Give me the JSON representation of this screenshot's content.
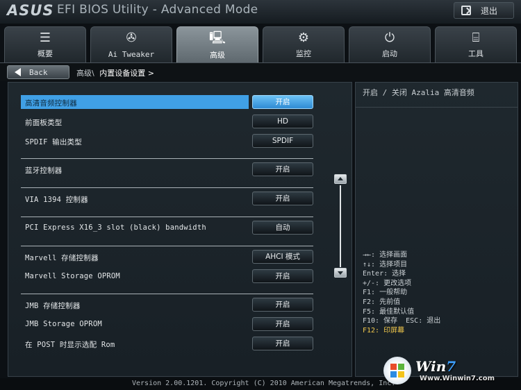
{
  "header": {
    "logo": "ASUS",
    "title": "EFI BIOS Utility - Advanced Mode",
    "exit_label": "退出"
  },
  "tabs": [
    {
      "label": "概要",
      "icon": "list-icon"
    },
    {
      "label": "Ai Tweaker",
      "icon": "fan-icon"
    },
    {
      "label": "高级",
      "icon": "info-monitor-icon",
      "active": true
    },
    {
      "label": "监控",
      "icon": "gauge-icon"
    },
    {
      "label": "启动",
      "icon": "power-icon"
    },
    {
      "label": "工具",
      "icon": "toolbox-icon"
    }
  ],
  "nav": {
    "back_label": "Back",
    "crumb_parent": "高级\\",
    "crumb_current": "内置设备设置 >"
  },
  "settings": [
    {
      "label": "高清音频控制器",
      "value": "开启",
      "selected": true
    },
    {
      "label": "前面板类型",
      "value": "HD"
    },
    {
      "label": "SPDIF 输出类型",
      "value": "SPDIF"
    },
    {
      "label": "蓝牙控制器",
      "value": "开启"
    },
    {
      "label": "VIA 1394 控制器",
      "value": "开启"
    },
    {
      "label": "PCI Express X16_3 slot (black) bandwidth",
      "value": "自动"
    },
    {
      "label": "Marvell 存储控制器",
      "value": "AHCI 模式"
    },
    {
      "label": "Marvell Storage OPROM",
      "value": "开启"
    },
    {
      "label": "JMB 存储控制器",
      "value": "开启"
    },
    {
      "label": "JMB Storage OPROM",
      "value": "开启"
    },
    {
      "label": "在 POST 时显示选配 Rom",
      "value": "开启"
    }
  ],
  "help": {
    "description": "开启 / 关闭 Azalia 高清音频",
    "keys": [
      "→←: 选择画面",
      "↑↓: 选择项目",
      "Enter: 选择",
      "+/-: 更改选项",
      "F1: 一般帮助",
      "F2: 先前值",
      "F5: 最佳默认值",
      "F10: 保存  ESC: 退出"
    ],
    "highlight_key": "F12: 印屏幕"
  },
  "footer": {
    "text": "Version 2.00.1201. Copyright (C) 2010 American Megatrends, Inc."
  },
  "watermark": {
    "logo_main": "Win",
    "logo_num": "7",
    "url": "Www.Winwin7.com"
  },
  "colors": {
    "selection": "#40a0e6",
    "highlight_key": "#f2c94c",
    "background": "#0c1014"
  }
}
